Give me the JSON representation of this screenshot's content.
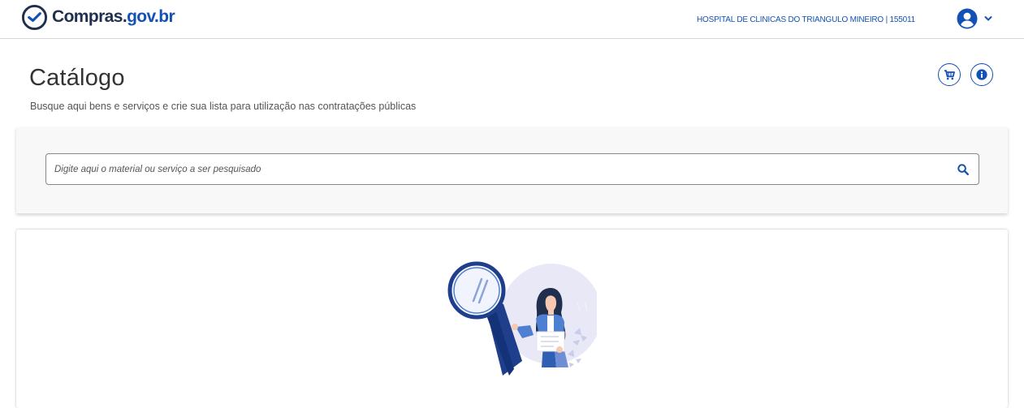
{
  "header": {
    "logo_prefix": "Compras.",
    "logo_suffix": "gov.br",
    "organization": "HOSPITAL DE CLINICAS DO TRIANGULO MINEIRO | 155011",
    "user_icon": "user-circle-icon",
    "menu_icon": "chevron-down-icon"
  },
  "page": {
    "title": "Catálogo",
    "subtitle": "Busque aqui bens e serviços e crie sua lista para utilização nas contratações públicas"
  },
  "actions": {
    "cart_icon": "cart-icon",
    "info_icon": "info-icon"
  },
  "search": {
    "placeholder": "Digite aqui o material ou serviço a ser pesquisado",
    "value": "",
    "icon": "search-icon"
  },
  "colors": {
    "brand_blue": "#1351b4",
    "dark_text": "#333333",
    "card_background": "#f8f8f8"
  }
}
